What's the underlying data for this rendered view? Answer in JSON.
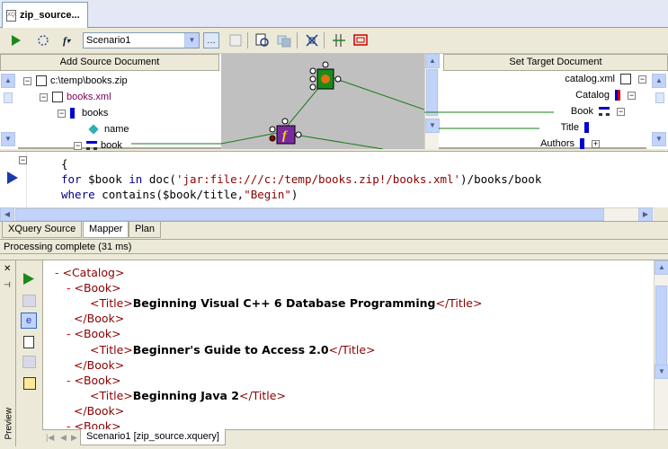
{
  "document_tab": {
    "title": "zip_source..."
  },
  "toolbar": {
    "scenario_value": "Scenario1",
    "buttons": [
      "run-icon",
      "debug-icon",
      "function-icon",
      "browse-icon",
      "preview-icon",
      "find-icon",
      "zoom-icon",
      "center-icon",
      "grid-icon",
      "fit-icon"
    ]
  },
  "mapper": {
    "source_header": "Add Source Document",
    "target_header": "Set Target Document",
    "source_tree": [
      {
        "label": "c:\\temp\\books.zip",
        "level": 0
      },
      {
        "label": "books.xml",
        "level": 1
      },
      {
        "label": "books",
        "level": 2
      },
      {
        "label": "name",
        "level": 3
      },
      {
        "label": "book",
        "level": 2
      }
    ],
    "target_tree": [
      {
        "label": "catalog.xml"
      },
      {
        "label": "Catalog"
      },
      {
        "label": "Book"
      },
      {
        "label": "Title"
      },
      {
        "label": "Authors"
      }
    ]
  },
  "editor": {
    "lines": [
      {
        "parts": [
          {
            "t": "{",
            "c": ""
          }
        ]
      },
      {
        "parts": [
          {
            "t": "for",
            "c": "kw"
          },
          {
            "t": " $book ",
            "c": ""
          },
          {
            "t": "in",
            "c": "kw"
          },
          {
            "t": " doc(",
            "c": ""
          },
          {
            "t": "'jar:file:///c:/temp/books.zip!/books.xml'",
            "c": "str"
          },
          {
            "t": ")/books/book",
            "c": ""
          }
        ]
      },
      {
        "parts": [
          {
            "t": "where",
            "c": "kw"
          },
          {
            "t": " contains($book/title,",
            "c": ""
          },
          {
            "t": "\"Begin\"",
            "c": "str"
          },
          {
            "t": ")",
            "c": ""
          }
        ]
      }
    ]
  },
  "bottom_tabs": [
    "XQuery Source",
    "Mapper",
    "Plan"
  ],
  "status_text": "Processing complete (31 ms)",
  "preview": {
    "side_label": "Preview",
    "xml_lines": [
      {
        "indent": 0,
        "dash": "- ",
        "open": "<Catalog>",
        "text": "",
        "close": ""
      },
      {
        "indent": 1,
        "dash": "- ",
        "open": "<Book>",
        "text": "",
        "close": ""
      },
      {
        "indent": 2,
        "dash": "",
        "open": "<Title>",
        "text": "Beginning Visual C++ 6 Database Programming",
        "close": "</Title>"
      },
      {
        "indent": 1,
        "dash": "  ",
        "open": "</Book>",
        "text": "",
        "close": ""
      },
      {
        "indent": 1,
        "dash": "- ",
        "open": "<Book>",
        "text": "",
        "close": ""
      },
      {
        "indent": 2,
        "dash": "",
        "open": "<Title>",
        "text": "Beginner's Guide to Access 2.0",
        "close": "</Title>"
      },
      {
        "indent": 1,
        "dash": "  ",
        "open": "</Book>",
        "text": "",
        "close": ""
      },
      {
        "indent": 1,
        "dash": "- ",
        "open": "<Book>",
        "text": "",
        "close": ""
      },
      {
        "indent": 2,
        "dash": "",
        "open": "<Title>",
        "text": "Beginning Java 2",
        "close": "</Title>"
      },
      {
        "indent": 1,
        "dash": "  ",
        "open": "</Book>",
        "text": "",
        "close": ""
      },
      {
        "indent": 1,
        "dash": "- ",
        "open": "<Book>",
        "text": "",
        "close": ""
      }
    ],
    "bottom_tab": "Scenario1 [zip_source.xquery]"
  }
}
